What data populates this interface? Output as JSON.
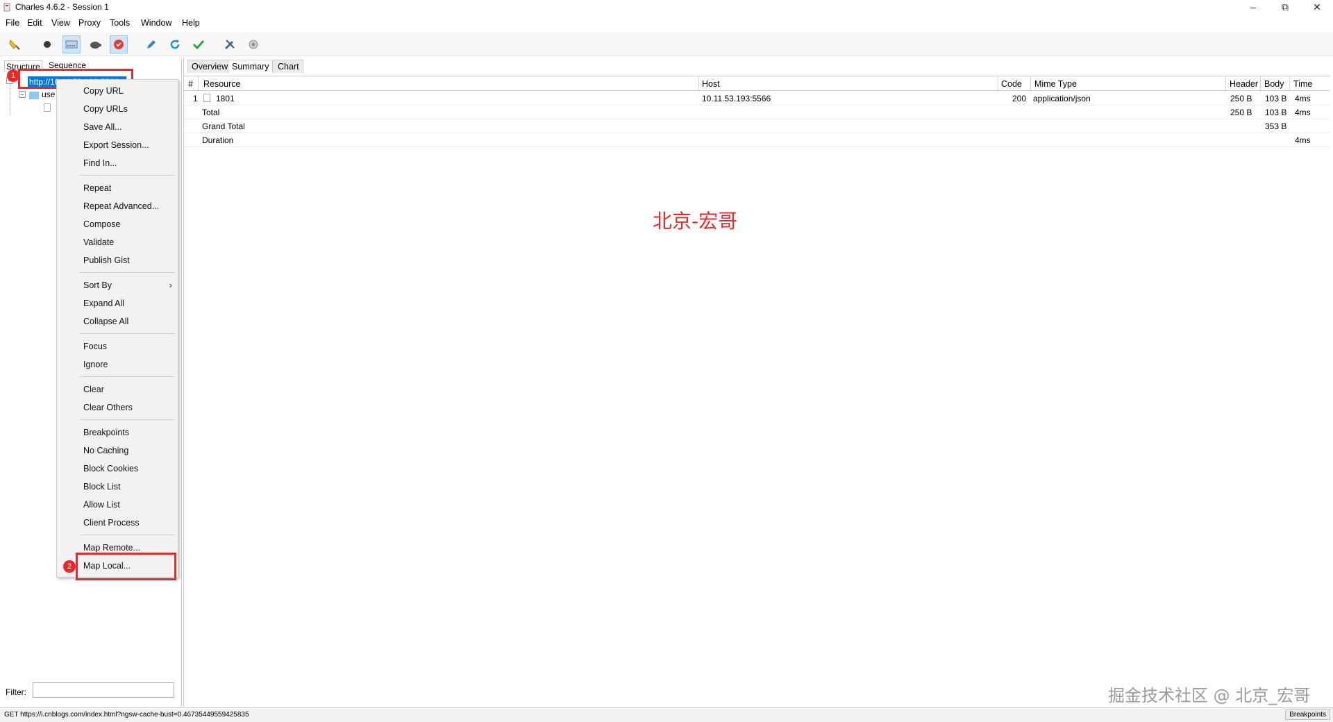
{
  "window": {
    "title": "Charles 4.6.2 - Session 1"
  },
  "menubar": [
    "File",
    "Edit",
    "View",
    "Proxy",
    "Tools",
    "Window",
    "Help"
  ],
  "toolbar": {
    "icons": [
      "broom-icon",
      "record-icon",
      "throttle-icon",
      "turtle-icon",
      "breakpoint-icon",
      "pen-icon",
      "refresh-icon",
      "check-icon",
      "tools-icon",
      "settings-icon"
    ]
  },
  "left_tabs": {
    "structure": "Structure",
    "sequence": "Sequence"
  },
  "tree": {
    "selected_host": "http://10.11.53.193:5566",
    "child": "use"
  },
  "badges": {
    "one": "1",
    "two": "2"
  },
  "context_menu": {
    "items": [
      "Copy URL",
      "Copy URLs",
      "Save All...",
      "Export Session...",
      "Find In...",
      "Repeat",
      "Repeat Advanced...",
      "Compose",
      "Validate",
      "Publish Gist",
      "Sort By",
      "Expand All",
      "Collapse All",
      "Focus",
      "Ignore",
      "Clear",
      "Clear Others",
      "Breakpoints",
      "No Caching",
      "Block Cookies",
      "Block List",
      "Allow List",
      "Client Process",
      "Map Remote...",
      "Map Local..."
    ]
  },
  "filter": {
    "label": "Filter:",
    "value": ""
  },
  "right_tabs": [
    "Overview",
    "Summary",
    "Chart"
  ],
  "table": {
    "columns": [
      "#",
      "Resource",
      "Host",
      "Code",
      "Mime Type",
      "Header",
      "Body",
      "Time"
    ],
    "rows": [
      {
        "num": "1",
        "resource": "1801",
        "host": "10.11.53.193:5566",
        "code": "200",
        "mime": "application/json",
        "header": "250 B",
        "body": "103 B",
        "time": "4ms"
      },
      {
        "num": "",
        "resource": "Total",
        "host": "",
        "code": "",
        "mime": "",
        "header": "250 B",
        "body": "103 B",
        "time": "4ms"
      },
      {
        "num": "",
        "resource": "Grand Total",
        "host": "",
        "code": "",
        "mime": "",
        "header": "",
        "body": "353 B",
        "time": ""
      },
      {
        "num": "",
        "resource": "Duration",
        "host": "",
        "code": "",
        "mime": "",
        "header": "",
        "body": "",
        "time": "4ms"
      }
    ]
  },
  "watermarks": {
    "center": "北京-宏哥",
    "corner": "掘金技术社区 @ 北京_宏哥"
  },
  "statusbar": {
    "text": "GET https://i.cnblogs.com/index.html?ngsw-cache-bust=0.46735449559425835",
    "button": "Breakpoints"
  },
  "colors": {
    "highlight": "#e8282a",
    "selection": "#0078d7"
  }
}
